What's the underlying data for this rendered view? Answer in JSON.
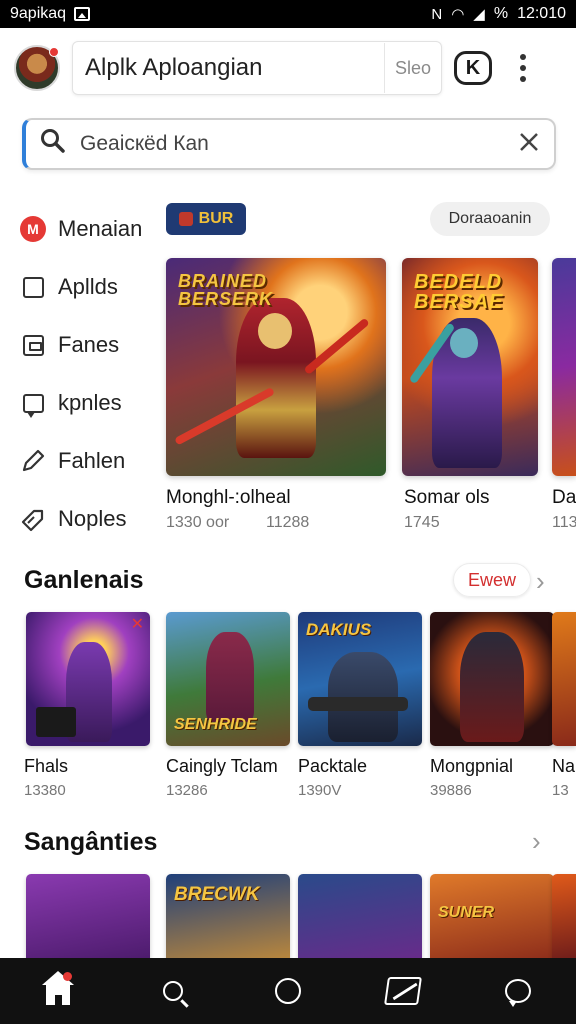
{
  "status_bar": {
    "carrier": "9apikaq",
    "time": "12:010",
    "battery_label": "%"
  },
  "header": {
    "title": "Alplk Aploangian",
    "secondary_label": "Sleo",
    "k_button_label": "K"
  },
  "search": {
    "query": "Geaicкёd Кan"
  },
  "sidebar": {
    "items": [
      {
        "label": "Menaian",
        "icon": "brand-icon"
      },
      {
        "label": "Apllds",
        "icon": "square-icon"
      },
      {
        "label": "Fanes",
        "icon": "document-icon"
      },
      {
        "label": "kpnles",
        "icon": "chat-icon"
      },
      {
        "label": "Fahlen",
        "icon": "pencil-icon"
      },
      {
        "label": "Noples",
        "icon": "tag-icon"
      }
    ]
  },
  "featured": {
    "chip_left": "BUR",
    "chip_right": "Doraaoanin",
    "cards": [
      {
        "art_label": "BRAINED BERSERK",
        "title": "Monghl-:olheal",
        "meta1": "1330 oor",
        "meta2": "11288",
        "accent": "#8a1f2a"
      },
      {
        "art_label": "BEDELD BERSAE",
        "title": "Somar ols",
        "meta1": "1745",
        "meta2": "",
        "accent": "#c24a1c"
      },
      {
        "art_label": "",
        "title": "Da",
        "meta1": "113",
        "meta2": "",
        "accent": "#5a2a8a"
      }
    ]
  },
  "section1": {
    "title": "Ganlenais",
    "action_label": "Ewew",
    "tiles": [
      {
        "art_label": "",
        "title": "Fhals",
        "meta": "13380",
        "accent": "#6a2ba0"
      },
      {
        "art_label": "SENHRIDE",
        "title": "Caingly Tclam",
        "meta": "13286",
        "accent": "#3f7a3a"
      },
      {
        "art_label": "DAKIUS",
        "title": "Packtale",
        "meta": "1390V",
        "accent": "#1f5aa0"
      },
      {
        "art_label": "",
        "title": "Mongpnial",
        "meta": "39886",
        "accent": "#c8451a"
      },
      {
        "art_label": "",
        "title": "Na",
        "meta": "13",
        "accent": "#d4701a"
      }
    ]
  },
  "section2": {
    "title": "Sangânties",
    "tiles": [
      {
        "art_label": "",
        "accent": "#6a2ba0"
      },
      {
        "art_label": "BRECWK",
        "accent": "#1f3f7a"
      },
      {
        "art_label": "",
        "accent": "#2a4a8a"
      },
      {
        "art_label": "SUNER",
        "accent": "#c8451a"
      },
      {
        "art_label": "",
        "accent": "#c8451a"
      }
    ]
  },
  "bottom_nav": {
    "items": [
      "home-icon",
      "search-icon",
      "circle-icon",
      "photo-icon",
      "chat-icon"
    ]
  }
}
